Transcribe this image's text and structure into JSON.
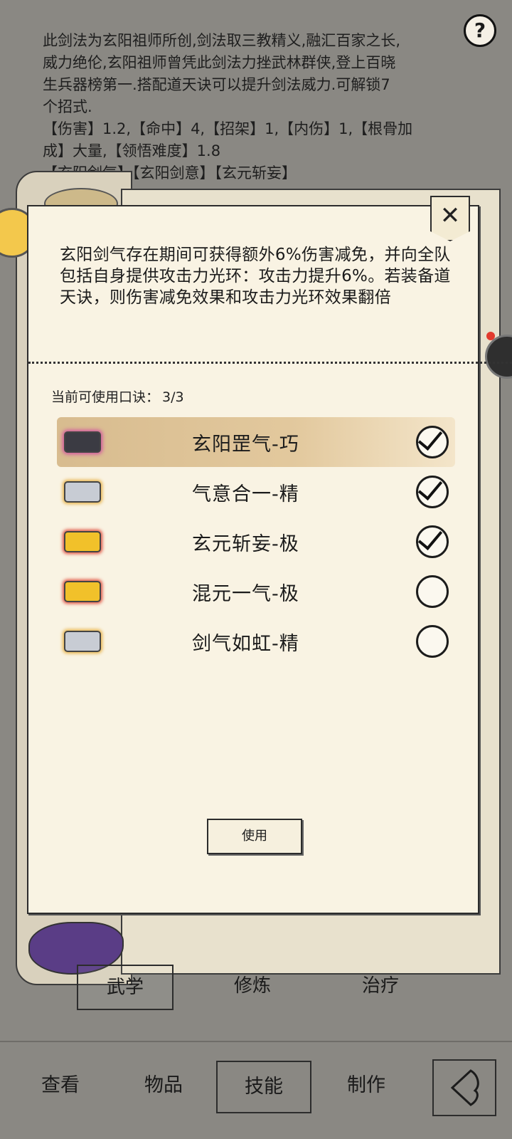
{
  "background_text": {
    "lines": [
      "此剑法为玄阳祖师所创,剑法取三教精义,融汇百家之长,",
      "威力绝伦,玄阳祖师曾凭此剑法力挫武林群侠,登上百晓",
      "生兵器榜第一.搭配道天诀可以提升剑法威力.可解锁7",
      "个招式.",
      "【伤害】1.2,【命中】4,【招架】1,【内伤】1,【根骨加",
      "成】大量,【领悟难度】1.8",
      "【玄阳剑气】【玄阳剑意】【玄元斩妄】"
    ]
  },
  "help_icon": "?",
  "dialog": {
    "close_symbol": "✕",
    "description": "玄阳剑气存在期间可获得额外6%伤害减免，并向全队包括自身提供攻击力光环：攻击力提升6%。若装备道天诀，则伤害减免效果和攻击力光环效果翻倍",
    "available_label": "当前可使用口诀：",
    "available_count": "3/3",
    "items": [
      {
        "name": "玄阳罡气-巧",
        "checked": true,
        "chip": "dark"
      },
      {
        "name": "气意合一-精",
        "checked": true,
        "chip": "silver"
      },
      {
        "name": "玄元斩妄-极",
        "checked": true,
        "chip": "gold"
      },
      {
        "name": "混元一气-极",
        "checked": false,
        "chip": "gold"
      },
      {
        "name": "剑气如虹-精",
        "checked": false,
        "chip": "silver"
      }
    ],
    "use_button": "使用"
  },
  "subtabs": {
    "martial": "武学",
    "cultivate": "修炼",
    "heal": "治疗"
  },
  "bottom_nav": {
    "view": "查看",
    "items": "物品",
    "skills": "技能",
    "craft": "制作"
  }
}
